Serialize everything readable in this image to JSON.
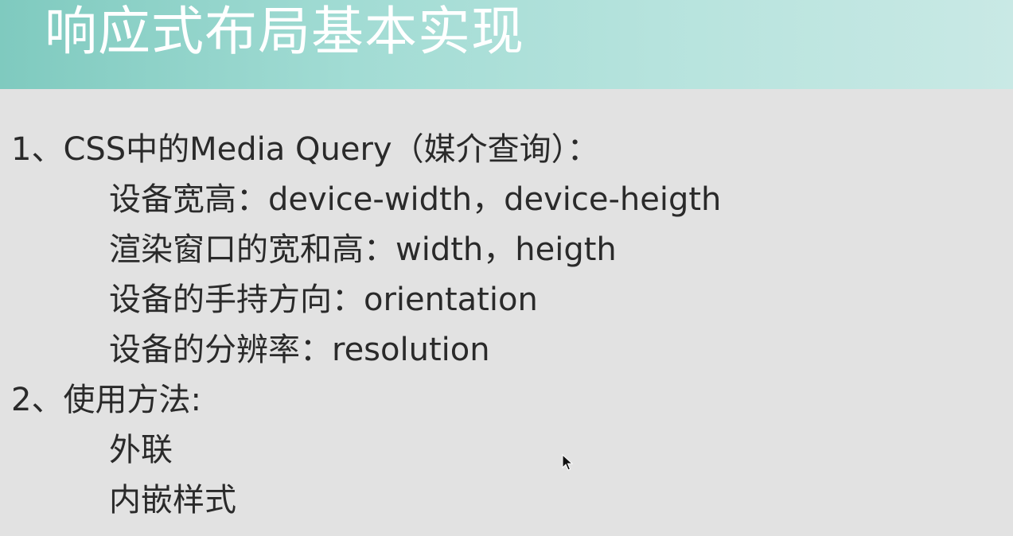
{
  "slide": {
    "title": "响应式布局基本实现",
    "items": [
      {
        "heading": "1、CSS中的Media Query（媒介查询）：",
        "subitems": [
          "设备宽高：device-width，device-heigth",
          "渲染窗口的宽和高：width，heigth",
          "设备的手持方向：orientation",
          "设备的分辨率：resolution"
        ]
      },
      {
        "heading": "2、使用方法:",
        "subitems": [
          "外联",
          "内嵌样式"
        ]
      }
    ]
  },
  "colors": {
    "title_bar_start": "#7fcabf",
    "title_bar_end": "#c9e9e5",
    "background": "#e2e2e2",
    "text": "#2a2a2a",
    "title_text": "#ffffff"
  },
  "icons": {
    "cursor": "mouse-pointer-icon"
  }
}
